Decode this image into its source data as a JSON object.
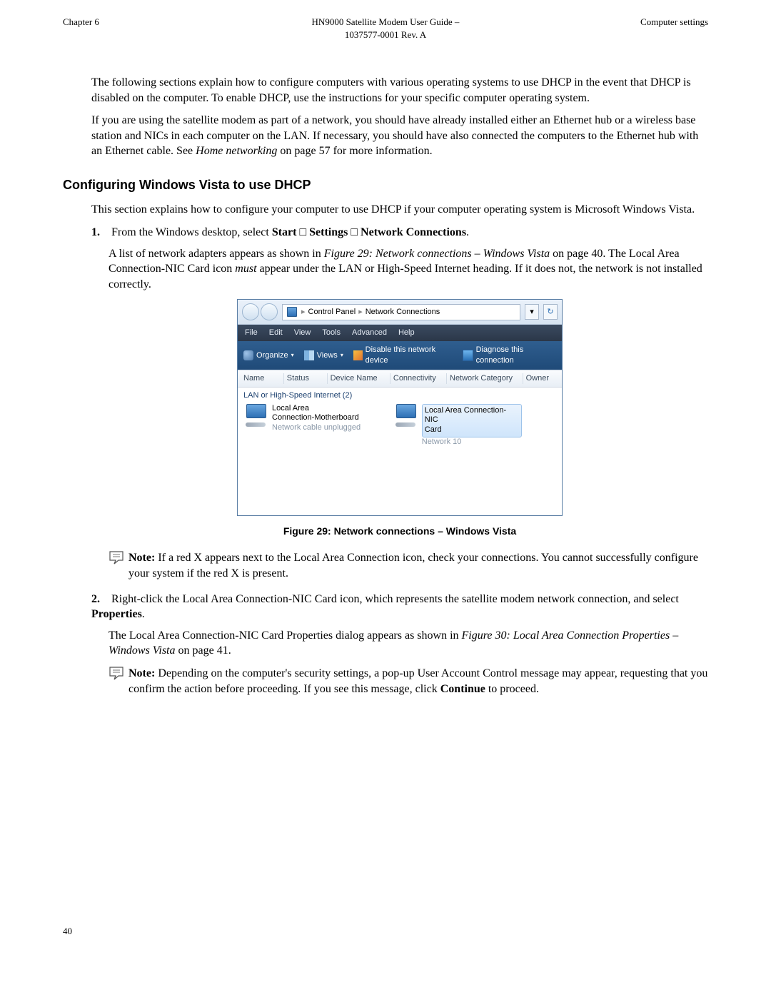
{
  "header": {
    "left": "Chapter 6",
    "center_line1": "HN9000 Satellite Modem User Guide –",
    "center_line2": "1037577-0001 Rev. A",
    "right": "Computer settings"
  },
  "intro": {
    "p1": "The following sections explain how to configure computers with various operating systems to use DHCP in the event that DHCP is disabled on the computer. To enable DHCP, use the instructions for your specific computer operating system.",
    "p2a": "If you are using the satellite modem as part of a network, you should have already installed either an Ethernet hub or a wireless base station and NICs in each computer on the LAN. If necessary, you should have also connected the computers to the Ethernet hub with an Ethernet cable. See ",
    "p2_em": "Home networking",
    "p2b": " on page 57 for more information."
  },
  "section_heading": "Configuring Windows Vista to use DHCP",
  "section_intro": "This section explains how to configure your computer to use DHCP if your computer operating system is Microsoft Windows Vista.",
  "steps": {
    "s1": {
      "marker": "1.",
      "line_a": "From the Windows desktop, select ",
      "b_start": "Start",
      "arrow1": " □ ",
      "b_settings": "Settings",
      "arrow2": " □ ",
      "b_net": "Network Connections",
      "line_end": ".",
      "body_a": "A list of network adapters appears as shown in ",
      "body_em": "Figure 29: Network connections – Windows Vista",
      "body_b": " on page 40. The Local Area Connection-NIC Card icon ",
      "body_em2": "must",
      "body_c": " appear under the LAN or High-Speed Internet heading. If it does not, the network is not installed correctly."
    },
    "s2": {
      "marker": "2.",
      "line_a": "Right-click the Local Area Connection-NIC Card icon, which represents the satellite modem network connection, and select ",
      "b_prop": "Properties",
      "line_end": ".",
      "body_a": "The Local Area Connection-NIC Card Properties dialog appears as shown in ",
      "body_em": "Figure 30: Local Area Connection Properties – Windows Vista",
      "body_b": " on page 41."
    }
  },
  "figure_caption": "Figure 29: Network connections – Windows Vista",
  "notes": {
    "n1_label": "Note:",
    "n1_body": "  If a red X appears next to the Local Area Connection icon, check your connections. You cannot successfully configure your system if the red X is present.",
    "n2_label": "Note:",
    "n2_body_a": "  Depending on the computer's security settings, a pop-up User Account Control message may appear, requesting that you confirm the action before proceeding. If you see this message, click ",
    "n2_b": "Continue",
    "n2_body_b": " to proceed."
  },
  "vista": {
    "crumb1": "Control Panel",
    "crumb2": "Network Connections",
    "menu": {
      "file": "File",
      "edit": "Edit",
      "view": "View",
      "tools": "Tools",
      "advanced": "Advanced",
      "help": "Help"
    },
    "toolbar": {
      "organize": "Organize",
      "views": "Views",
      "disable": "Disable this network device",
      "diagnose": "Diagnose this connection"
    },
    "cols": {
      "name": "Name",
      "status": "Status",
      "device": "Device Name",
      "conn": "Connectivity",
      "cat": "Network Category",
      "owner": "Owner"
    },
    "group": "LAN or High-Speed Internet (2)",
    "item1": {
      "l1": "Local Area",
      "l2": "Connection-Motherboard",
      "l3": "Network cable unplugged"
    },
    "item2": {
      "l1": "Local Area Connection-NIC",
      "l2": "Card",
      "l3": "Network 10"
    }
  },
  "page_number": "40"
}
